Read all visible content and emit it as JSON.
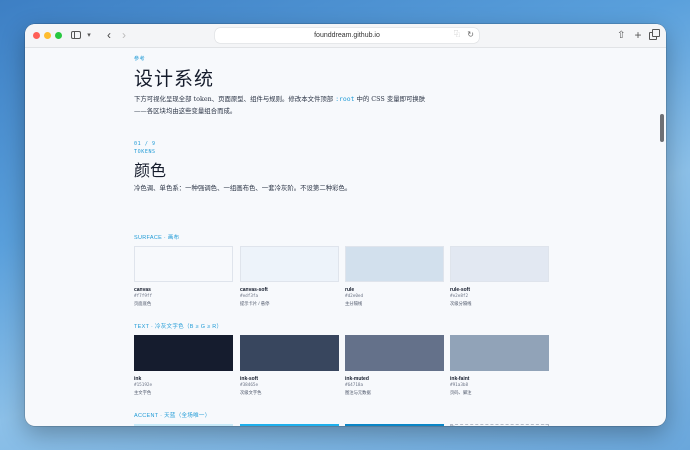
{
  "browser": {
    "url": "founddream.github.io"
  },
  "page": {
    "eyebrow": "参考",
    "title": "设计系统",
    "intro_before": "下方可视化呈现全部 token、页面原型、组件与规则。修改本文件顶部 ",
    "intro_code": ":root",
    "intro_after": " 中的 CSS 变量即可换肤——各区块均由这些变量组合而成。"
  },
  "section": {
    "counter": "01 / 9",
    "kicker": "TOKENS",
    "title": "颜色",
    "description": "冷色调、单色系：一种强调色、一组画布色、一套冷灰阶。不设第二种彩色。"
  },
  "groups": [
    {
      "label": "SURFACE · 画布",
      "swatches": [
        {
          "name": "canvas",
          "hex": "#f7f9ff",
          "use": "页面底色",
          "color": "#f7f9fc"
        },
        {
          "name": "canvas-soft",
          "hex": "#edf3fa",
          "use": "提示卡片 / 悬停",
          "color": "#edf3fa"
        },
        {
          "name": "rule",
          "hex": "#d2e0ed",
          "use": "主分隔线",
          "color": "#d2e0ed"
        },
        {
          "name": "rule-soft",
          "hex": "#e2e8f2",
          "use": "次级分隔线",
          "color": "#e2e8f2"
        }
      ]
    },
    {
      "label": "TEXT · 冷灰文字色（B ≥ G ≥ R）",
      "swatches": [
        {
          "name": "ink",
          "hex": "#15192e",
          "use": "主文字色",
          "color": "#151c2e"
        },
        {
          "name": "ink-soft",
          "hex": "#38465e",
          "use": "次级文字色",
          "color": "#38465e"
        },
        {
          "name": "ink-muted",
          "hex": "#64718a",
          "use": "图注与元数据",
          "color": "#64718a"
        },
        {
          "name": "ink-faint",
          "hex": "#91a3b8",
          "use": "页码、脚注",
          "color": "#91a3b8"
        }
      ]
    },
    {
      "label": "ACCENT · 天蓝（全场唯一）",
      "swatches": [
        {
          "color": "#c8eaf8"
        },
        {
          "color": "#1fb0ec"
        },
        {
          "color": "#0b86c6"
        },
        {
          "color": "dashed"
        }
      ]
    }
  ]
}
